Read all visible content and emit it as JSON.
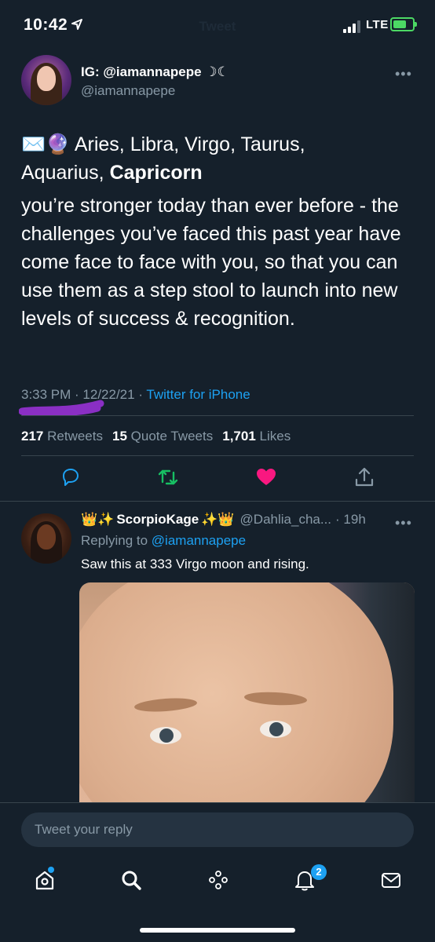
{
  "status_bar": {
    "time": "10:42",
    "network": "LTE",
    "ghost_title": "Tweet"
  },
  "tweet": {
    "author_name": "IG: @iamannapepe ☽☾",
    "author_handle": "@iamannapepe",
    "emoji_prefix": "✉️🔮",
    "signs_line": "Aries, Libra, Virgo, Taurus,",
    "signs_line2_plain": "Aquarius, ",
    "signs_line2_bold": "Capricorn",
    "body": "you’re stronger today than ever before - the challenges you’ve faced this past year have come face to face with you, so that you can use them as a step stool to launch into new levels of success & recognition.",
    "time": "3:33 PM",
    "date": "12/22/21",
    "source": "Twitter for iPhone",
    "retweets_count": "217",
    "retweets_label": "Retweets",
    "quote_count": "15",
    "quote_label": "Quote Tweets",
    "likes_count": "1,701",
    "likes_label": "Likes",
    "liked_color": "#f91880",
    "accent_color": "#1da1f2"
  },
  "actions": {
    "reply_icon": "reply-icon",
    "retweet_icon": "retweet-icon",
    "like_icon": "heart-icon",
    "share_icon": "share-icon"
  },
  "reply": {
    "name_prefix": "👑✨",
    "name": "ScorpioKage",
    "name_suffix": "✨👑",
    "handle": "@Dahlia_cha...",
    "age": "· 19h",
    "replying_label": "Replying to",
    "replying_to": "@iamannapepe",
    "text": "Saw this at 333 Virgo moon and rising."
  },
  "composer": {
    "placeholder": "Tweet your reply"
  },
  "tab_bar": {
    "notifications_badge": "2",
    "items": [
      "home-icon",
      "search-icon",
      "spaces-icon",
      "notifications-icon",
      "messages-icon"
    ]
  }
}
